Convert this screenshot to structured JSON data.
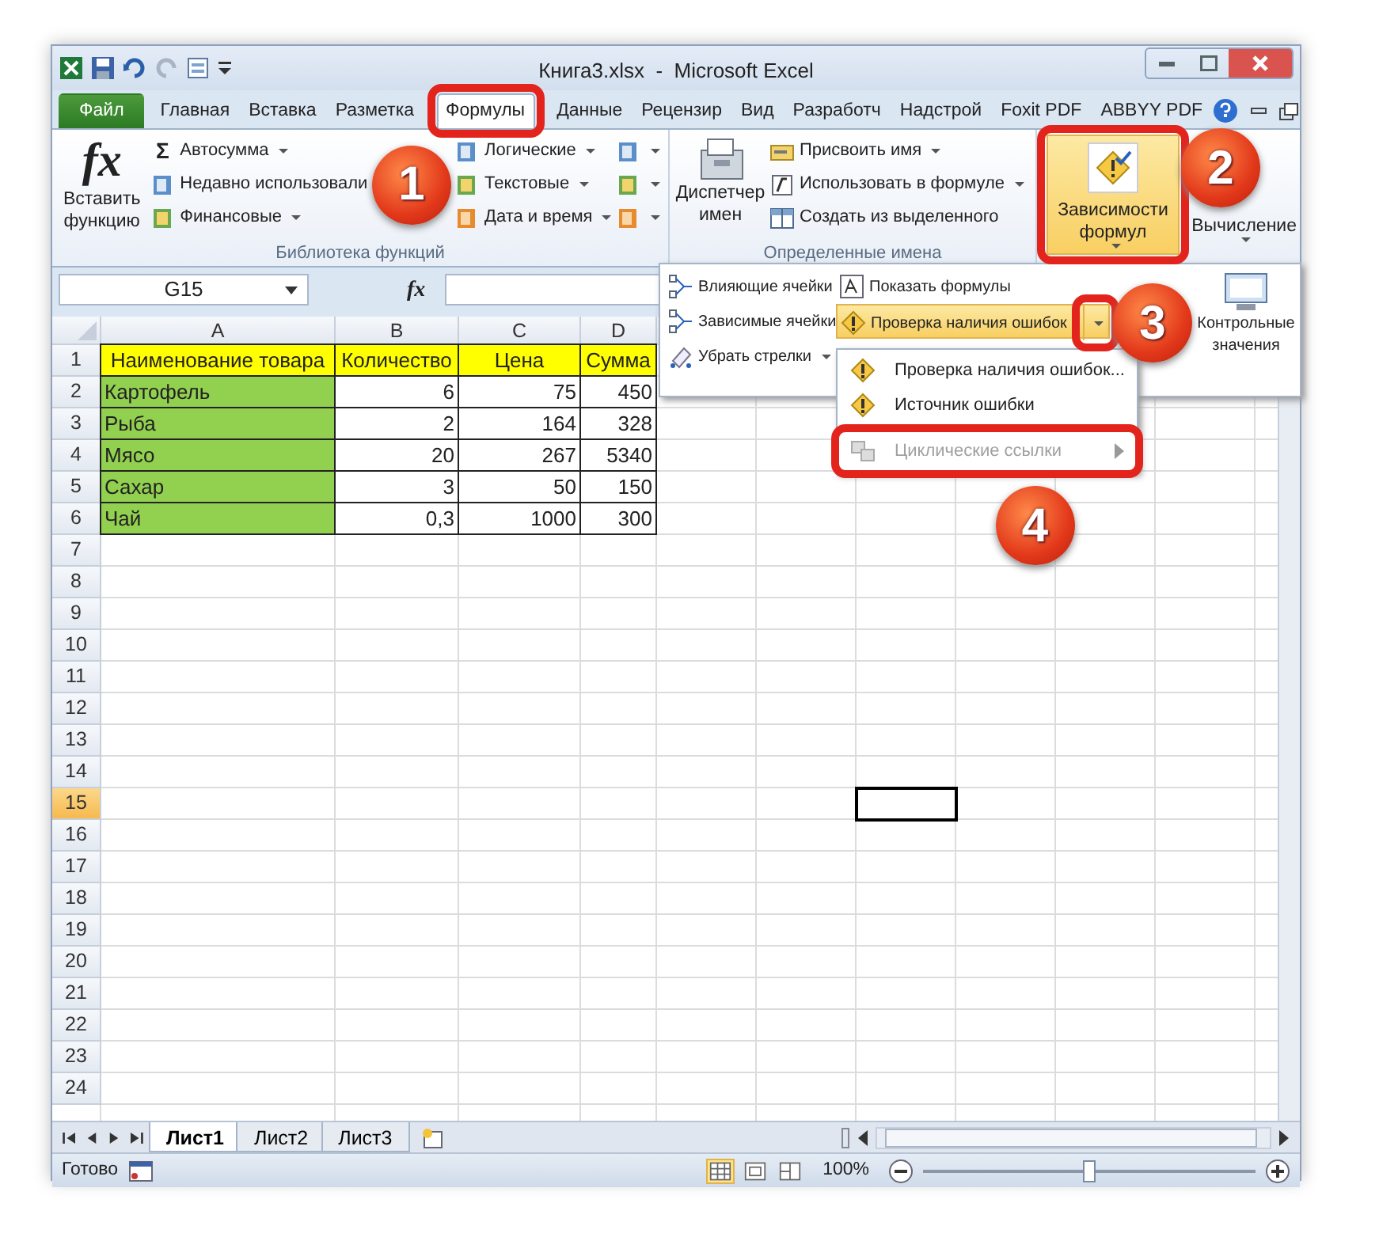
{
  "window": {
    "title": "Книга3.xlsx  -  Microsoft Excel"
  },
  "tabs": [
    {
      "label": "Файл",
      "kind": "file",
      "selected": false
    },
    {
      "label": "Главная",
      "kind": "tab",
      "selected": false
    },
    {
      "label": "Вставка",
      "kind": "tab",
      "selected": false
    },
    {
      "label": "Разметка",
      "kind": "tab",
      "selected": false
    },
    {
      "label": "Формулы",
      "kind": "tab",
      "selected": true
    },
    {
      "label": "Данные",
      "kind": "tab",
      "selected": false
    },
    {
      "label": "Рецензир",
      "kind": "tab",
      "selected": false
    },
    {
      "label": "Вид",
      "kind": "tab",
      "selected": false
    },
    {
      "label": "Разработч",
      "kind": "tab",
      "selected": false
    },
    {
      "label": "Надстрой",
      "kind": "tab",
      "selected": false
    },
    {
      "label": "Foxit PDF",
      "kind": "tab",
      "selected": false
    },
    {
      "label": "ABBYY PDF",
      "kind": "tab",
      "selected": false
    }
  ],
  "ribbon": {
    "function_library": {
      "fx_symbol": "fx",
      "insert_function": "Вставить функцию",
      "autosum_symbol": "Σ",
      "items": [
        "Автосумма",
        "Недавно использовали",
        "Финансовые",
        "Логические",
        "Текстовые",
        "Дата и время"
      ],
      "label": "Библиотека функций"
    },
    "defined_names": {
      "manager": "Диспетчер имен",
      "items": [
        "Присвоить имя",
        "Использовать в формуле",
        "Создать из выделенного"
      ],
      "label": "Определенные имена"
    },
    "formula_auditing": {
      "label": "Зависимости формул",
      "expanded": true
    },
    "calculation": {
      "label": "Вычисление"
    }
  },
  "auditing_panel": {
    "left": [
      "Влияющие ячейки",
      "Зависимые ячейки",
      "Убрать стрелки"
    ],
    "show_formulas": "Показать формулы",
    "error_check": {
      "label": "Проверка наличия ошибок",
      "expanded": true
    },
    "watch": "Контрольные значения"
  },
  "error_menu": [
    {
      "label": "Проверка наличия ошибок...",
      "disabled": false,
      "kind": "check"
    },
    {
      "label": "Источник ошибки",
      "disabled": false,
      "kind": "trace"
    },
    {
      "label": "Циклические ссылки",
      "disabled": true,
      "kind": "circular"
    }
  ],
  "formula_bar": {
    "name_box": "G15",
    "fx_symbol": "fx"
  },
  "sheet": {
    "columns": [
      {
        "label": "A",
        "selected": false
      },
      {
        "label": "B",
        "selected": false
      },
      {
        "label": "C",
        "selected": false
      },
      {
        "label": "D",
        "selected": false
      },
      {
        "selected": false
      },
      {
        "selected": false
      },
      {
        "selected": true
      },
      {
        "selected": false
      },
      {
        "selected": false
      },
      {
        "selected": false
      }
    ],
    "rows": [
      {
        "label": "1",
        "selected": false,
        "kind": "header",
        "cells": [
          "Наименование товара",
          "Количество",
          "Цена",
          "Сумма"
        ]
      },
      {
        "label": "2",
        "selected": false,
        "kind": "data",
        "cells": [
          "Картофель",
          "6",
          "75",
          "450"
        ]
      },
      {
        "label": "3",
        "selected": false,
        "kind": "data",
        "cells": [
          "Рыба",
          "2",
          "164",
          "328"
        ]
      },
      {
        "label": "4",
        "selected": false,
        "kind": "data",
        "cells": [
          "Мясо",
          "20",
          "267",
          "5340"
        ]
      },
      {
        "label": "5",
        "selected": false,
        "kind": "data",
        "cells": [
          "Сахар",
          "3",
          "50",
          "150"
        ]
      },
      {
        "label": "6",
        "selected": false,
        "kind": "data",
        "cells": [
          "Чай",
          "0,3",
          "1000",
          "300"
        ]
      },
      {
        "label": "7",
        "selected": false
      },
      {
        "label": "8",
        "selected": false
      },
      {
        "label": "9",
        "selected": false
      },
      {
        "label": "10",
        "selected": false
      },
      {
        "label": "11",
        "selected": false
      },
      {
        "label": "12",
        "selected": false
      },
      {
        "label": "13",
        "selected": false
      },
      {
        "label": "14",
        "selected": false
      },
      {
        "label": "15",
        "selected": true
      },
      {
        "label": "16",
        "selected": false
      },
      {
        "label": "17",
        "selected": false
      },
      {
        "label": "18",
        "selected": false
      },
      {
        "label": "19",
        "selected": false
      },
      {
        "label": "20",
        "selected": false
      },
      {
        "label": "21",
        "selected": false
      },
      {
        "label": "22",
        "selected": false
      },
      {
        "label": "23",
        "selected": false
      },
      {
        "label": "24",
        "selected": false
      }
    ]
  },
  "sheet_tabs": [
    {
      "label": "Лист1",
      "selected": true
    },
    {
      "label": "Лист2",
      "selected": false
    },
    {
      "label": "Лист3",
      "selected": false
    }
  ],
  "status_bar": {
    "status": "Готово",
    "views": [
      {
        "kind": "normal",
        "selected": true
      },
      {
        "kind": "layout",
        "selected": false
      },
      {
        "kind": "break",
        "selected": false
      }
    ],
    "zoom": "100%",
    "level": 0.5
  },
  "callouts": [
    "1",
    "2",
    "3",
    "4"
  ]
}
